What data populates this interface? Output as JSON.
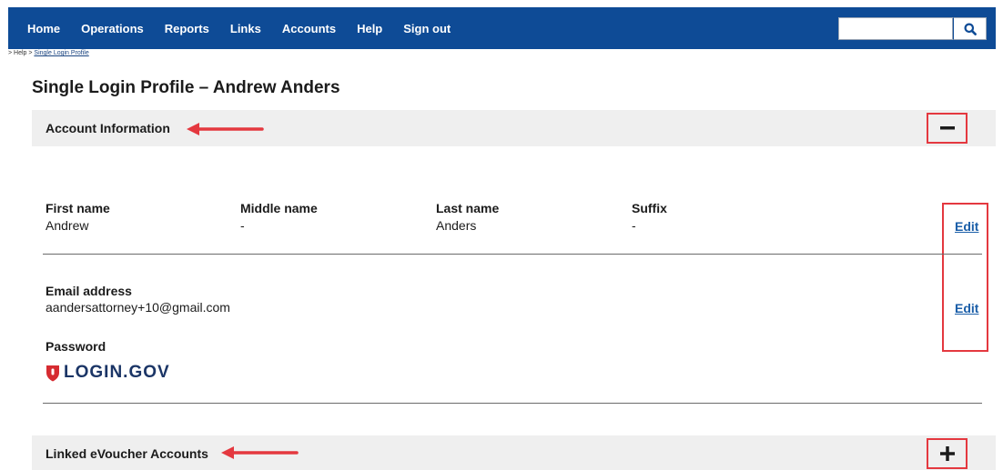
{
  "nav": {
    "items": [
      "Home",
      "Operations",
      "Reports",
      "Links",
      "Accounts",
      "Help",
      "Sign out"
    ],
    "search_value": ""
  },
  "breadcrumb": {
    "prefix": "> Help >",
    "current": "Single Login Profile"
  },
  "page": {
    "title": "Single Login Profile – Andrew Anders"
  },
  "account_section": {
    "label": "Account Information",
    "toggle": "−",
    "name": {
      "first_label": "First name",
      "first_value": "Andrew",
      "middle_label": "Middle name",
      "middle_value": "-",
      "last_label": "Last name",
      "last_value": "Anders",
      "suffix_label": "Suffix",
      "suffix_value": "-",
      "edit": "Edit"
    },
    "email": {
      "label": "Email address",
      "value": "aandersattorney+10@gmail.com",
      "edit": "Edit"
    },
    "password": {
      "label": "Password",
      "provider": "LOGIN.GOV"
    }
  },
  "linked_section": {
    "label": "Linked eVoucher Accounts",
    "toggle": "+"
  },
  "colors": {
    "nav_bg": "#0e4b96",
    "annotation_red": "#e4383f",
    "link_blue": "#1a5ea8",
    "logo_red": "#d62b31",
    "logo_navy": "#1b3566"
  },
  "icons": {
    "search": "search-icon",
    "logo": "login-gov-shield-icon",
    "arrow": "annotation-arrow-icon"
  }
}
